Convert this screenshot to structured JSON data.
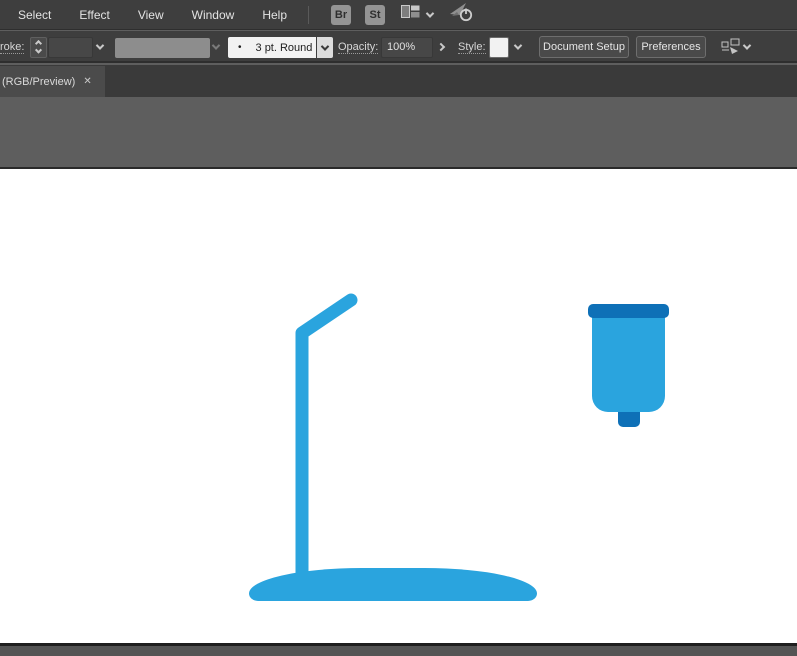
{
  "menubar": {
    "items": [
      "Select",
      "Effect",
      "View",
      "Window",
      "Help"
    ],
    "bridge_label": "Br",
    "stock_label": "St"
  },
  "controlbar": {
    "stroke_label": "roke:",
    "brush_bullet": "•",
    "brush_value": "3 pt. Round",
    "opacity_label": "Opacity:",
    "opacity_value": "100%",
    "style_label": "Style:",
    "document_setup_label": "Document Setup",
    "preferences_label": "Preferences"
  },
  "tab": {
    "label": "(RGB/Preview)",
    "close_glyph": "✕"
  },
  "canvas": {
    "shapes": [
      "lamp-stand",
      "container"
    ]
  },
  "colors": {
    "accent_blue": "#2aa4de",
    "accent_dark_blue": "#0e70b7",
    "ui_background": "#3e3e3e",
    "pasteboard": "#5e5e5e",
    "artboard": "#ffffff"
  }
}
